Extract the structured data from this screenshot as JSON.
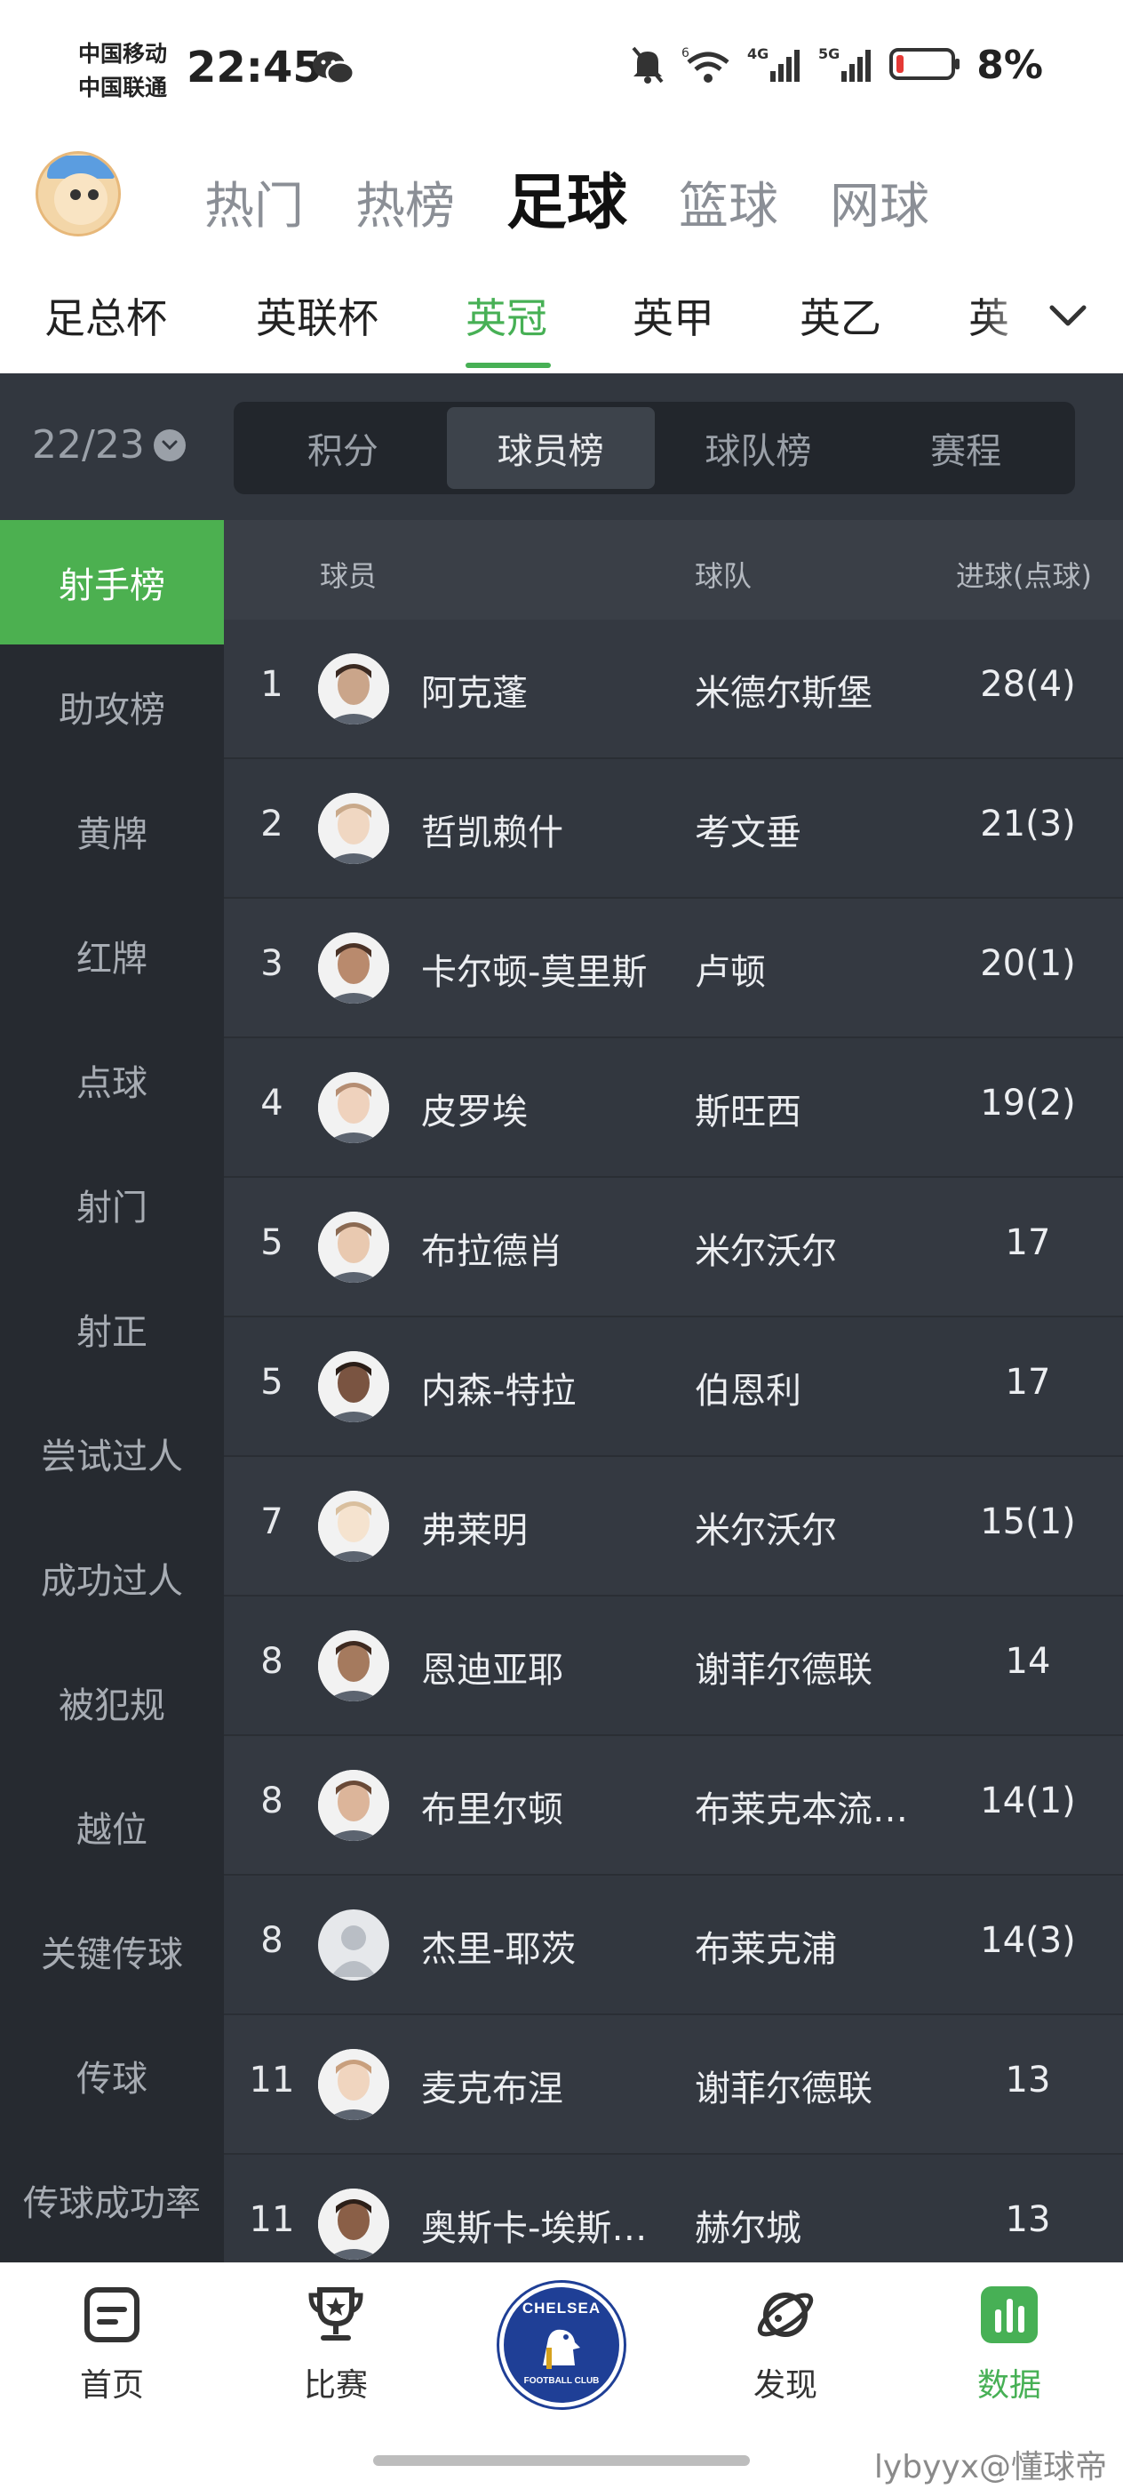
{
  "status_bar": {
    "carrier_1": "中国移动",
    "carrier_2": "中国联通",
    "time": "22:45",
    "battery": "8%",
    "icons": [
      "wechat-icon",
      "mute-icon",
      "wifi-icon",
      "signal-4g-icon",
      "signal-5g-icon",
      "battery-low-icon"
    ]
  },
  "top_nav": {
    "tabs": [
      "热门",
      "热榜",
      "足球",
      "篮球",
      "网球"
    ],
    "active": "足球"
  },
  "league_tabs": {
    "tabs": [
      "足总杯",
      "英联杯",
      "英冠",
      "英甲",
      "英乙",
      "英"
    ],
    "active": "英冠",
    "accent_color": "#47b055"
  },
  "season": {
    "label": "22/23"
  },
  "segment": {
    "tabs": [
      "积分",
      "球员榜",
      "球队榜",
      "赛程"
    ],
    "active": "球员榜"
  },
  "sidebar": {
    "items": [
      "射手榜",
      "助攻榜",
      "黄牌",
      "红牌",
      "点球",
      "射门",
      "射正",
      "尝试过人",
      "成功过人",
      "被犯规",
      "越位",
      "关键传球",
      "传球",
      "传球成功率"
    ],
    "active": "射手榜"
  },
  "table": {
    "headers": {
      "player": "球员",
      "team": "球队",
      "goals": "进球(点球)"
    },
    "rows": [
      {
        "rank": "1",
        "player": "阿克蓬",
        "team": "米德尔斯堡",
        "goals": "28(4)"
      },
      {
        "rank": "2",
        "player": "哲凯赖什",
        "team": "考文垂",
        "goals": "21(3)"
      },
      {
        "rank": "3",
        "player": "卡尔顿-莫里斯",
        "team": "卢顿",
        "goals": "20(1)"
      },
      {
        "rank": "4",
        "player": "皮罗埃",
        "team": "斯旺西",
        "goals": "19(2)"
      },
      {
        "rank": "5",
        "player": "布拉德肖",
        "team": "米尔沃尔",
        "goals": "17"
      },
      {
        "rank": "5",
        "player": "内森-特拉",
        "team": "伯恩利",
        "goals": "17"
      },
      {
        "rank": "7",
        "player": "弗莱明",
        "team": "米尔沃尔",
        "goals": "15(1)"
      },
      {
        "rank": "8",
        "player": "恩迪亚耶",
        "team": "谢菲尔德联",
        "goals": "14"
      },
      {
        "rank": "8",
        "player": "布里尔顿",
        "team": "布莱克本流…",
        "goals": "14(1)"
      },
      {
        "rank": "8",
        "player": "杰里-耶茨",
        "team": "布莱克浦",
        "goals": "14(3)"
      },
      {
        "rank": "11",
        "player": "麦克布涅",
        "team": "谢菲尔德联",
        "goals": "13"
      },
      {
        "rank": "11",
        "player": "奥斯卡-埃斯…",
        "team": "赫尔城",
        "goals": "13"
      }
    ]
  },
  "bottom_nav": {
    "items": [
      "首页",
      "比赛",
      "",
      "发现",
      "数据"
    ],
    "active": "数据",
    "club_badge_text": "CHELSEA",
    "club_badge_sub": "FOOTBALL CLUB"
  },
  "watermark": "lybyyx@懂球帝"
}
